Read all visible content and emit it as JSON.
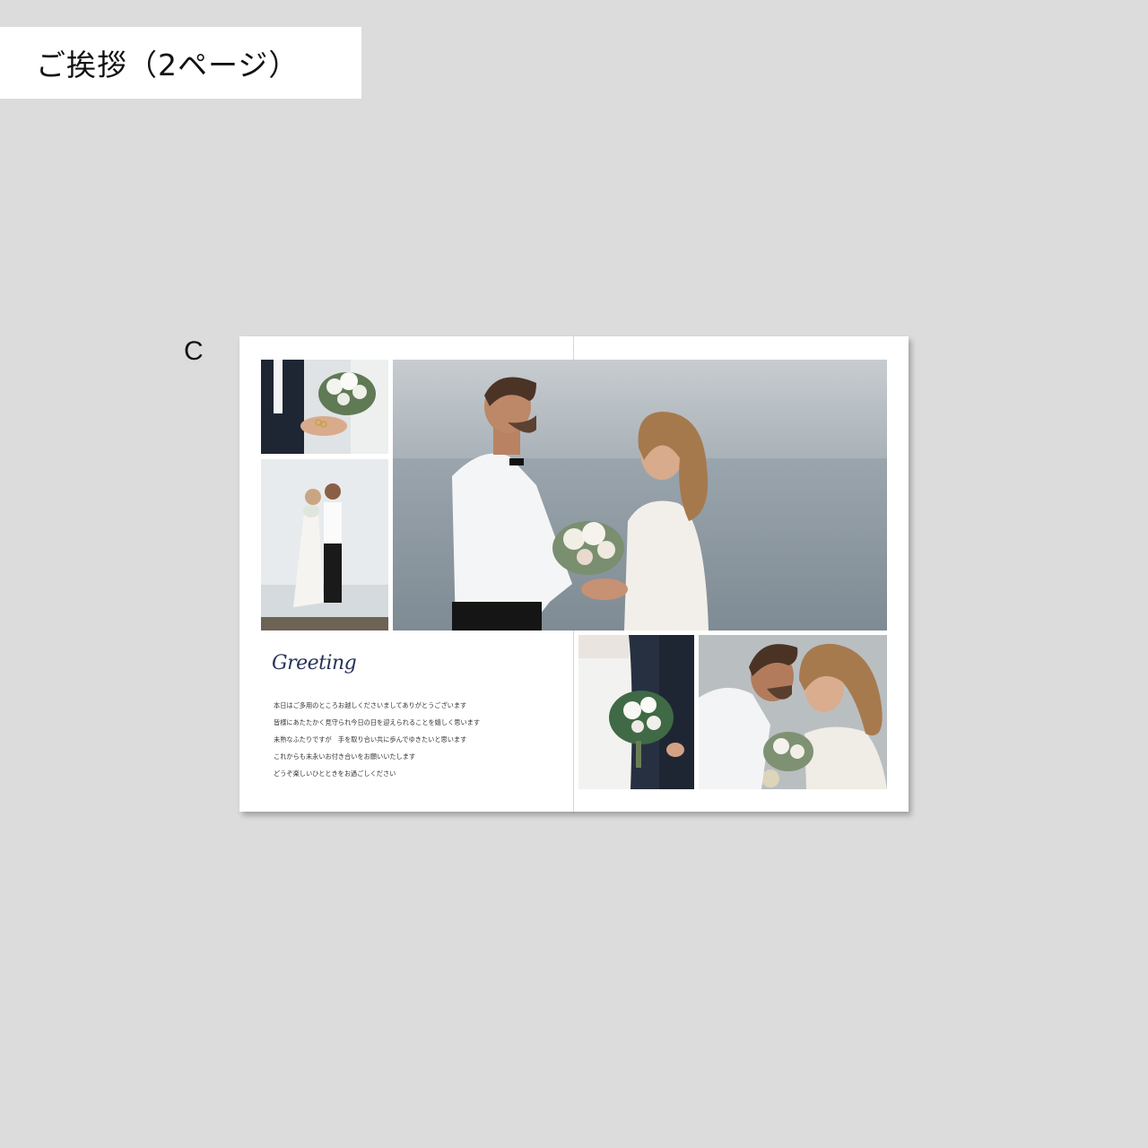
{
  "header": {
    "title": "ご挨拶（2ページ）"
  },
  "variant": {
    "label": "C"
  },
  "spread": {
    "heading": "Greeting",
    "message_lines": [
      "本日はご多用のところお越しくださいましてありがとうございます",
      "皆様にあたたかく見守られ今日の日を迎えられることを嬉しく思います",
      "未熟なふたりですが　手を取り合い共に歩んでゆきたいと思います",
      "これからも末永いお付き合いをお願いいたします",
      "どうぞ楽しいひとときをお過ごしください"
    ]
  },
  "colors": {
    "background": "#dcdcdc",
    "paper": "#ffffff",
    "heading": "#26345a",
    "sea": "#8c98a1",
    "sky": "#c3c9cd"
  }
}
